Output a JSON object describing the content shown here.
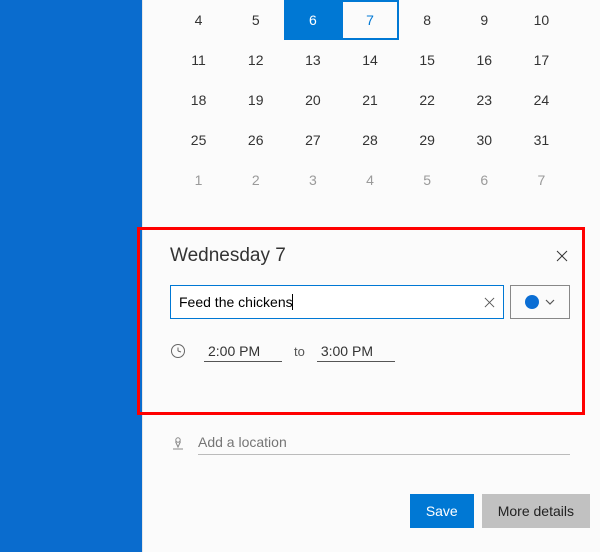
{
  "calendar": {
    "rows": [
      [
        {
          "d": 4
        },
        {
          "d": 5
        },
        {
          "d": 6,
          "today": true
        },
        {
          "d": 7,
          "selected": true
        },
        {
          "d": 8
        },
        {
          "d": 9
        },
        {
          "d": 10
        }
      ],
      [
        {
          "d": 11
        },
        {
          "d": 12
        },
        {
          "d": 13
        },
        {
          "d": 14
        },
        {
          "d": 15
        },
        {
          "d": 16
        },
        {
          "d": 17
        }
      ],
      [
        {
          "d": 18
        },
        {
          "d": 19
        },
        {
          "d": 20
        },
        {
          "d": 21
        },
        {
          "d": 22
        },
        {
          "d": 23
        },
        {
          "d": 24
        }
      ],
      [
        {
          "d": 25
        },
        {
          "d": 26
        },
        {
          "d": 27
        },
        {
          "d": 28
        },
        {
          "d": 29
        },
        {
          "d": 30
        },
        {
          "d": 31
        }
      ],
      [
        {
          "d": 1,
          "dim": true
        },
        {
          "d": 2,
          "dim": true
        },
        {
          "d": 3,
          "dim": true
        },
        {
          "d": 4,
          "dim": true
        },
        {
          "d": 5,
          "dim": true
        },
        {
          "d": 6,
          "dim": true
        },
        {
          "d": 7,
          "dim": true
        }
      ]
    ]
  },
  "event": {
    "date_label": "Wednesday 7",
    "title_value": "Feed the chickens",
    "start_time": "2:00 PM",
    "to_label": "to",
    "end_time": "3:00 PM",
    "color": "#0b6ed4"
  },
  "location": {
    "placeholder": "Add a location",
    "value": ""
  },
  "buttons": {
    "save": "Save",
    "details": "More details"
  }
}
